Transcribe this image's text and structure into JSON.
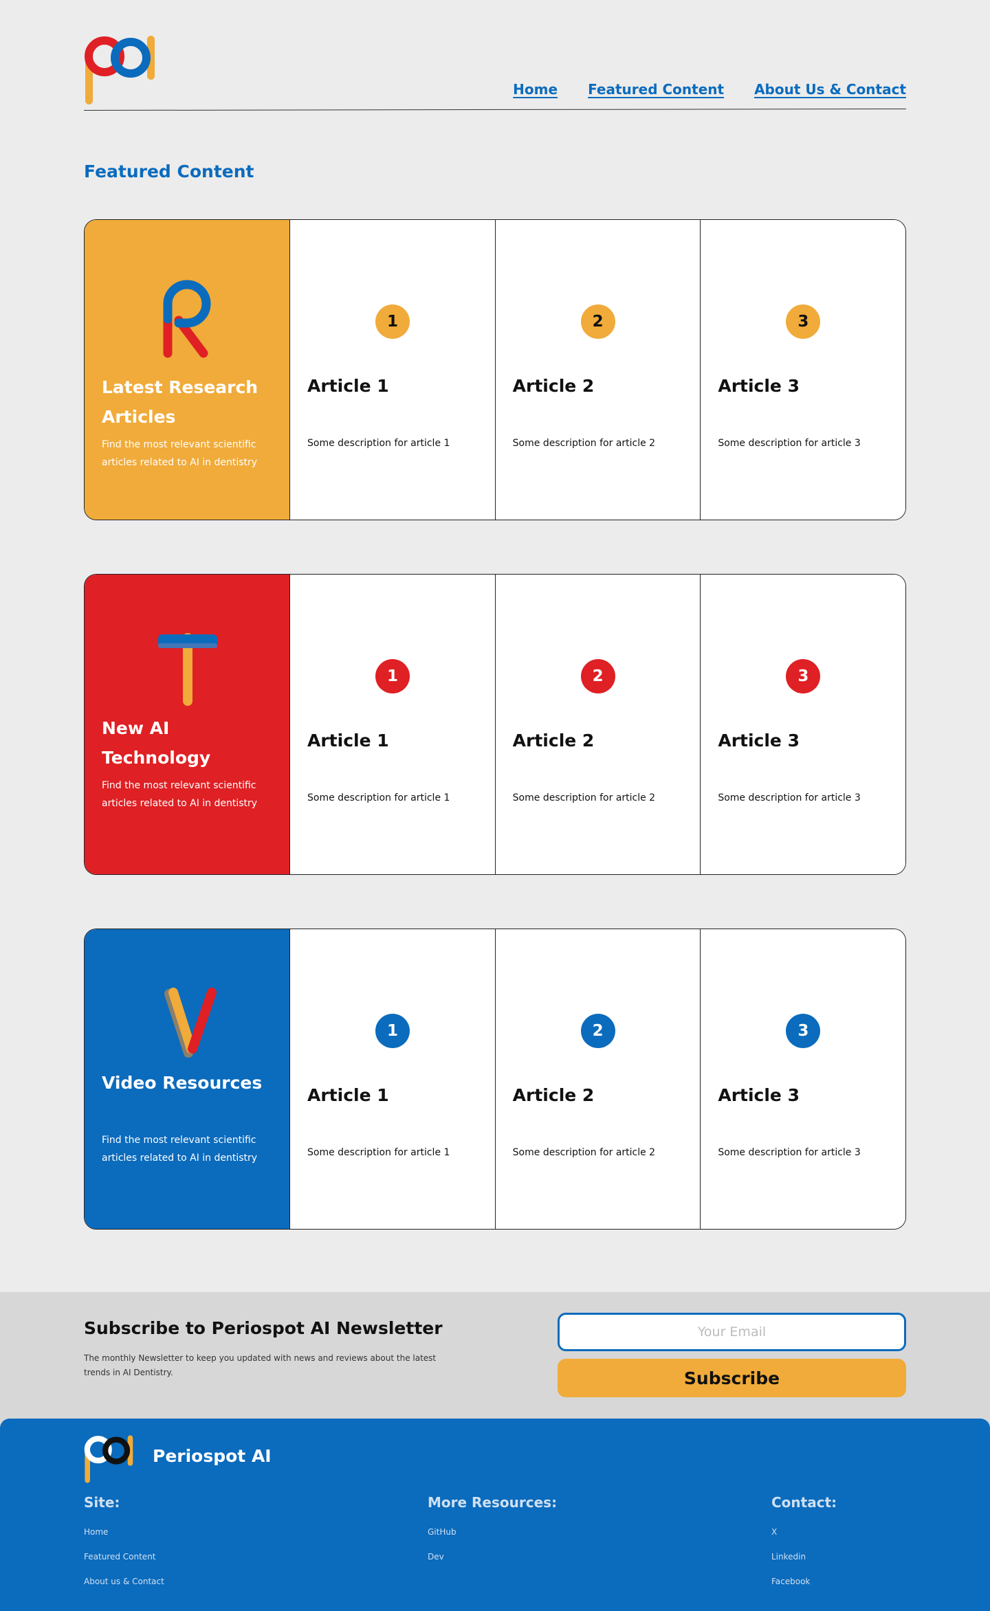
{
  "colors": {
    "blue": "#0b6bbd",
    "red": "#df2024",
    "yellow": "#f0ab3a"
  },
  "nav": {
    "home": "Home",
    "featured": "Featured Content",
    "about": "About Us & Contact"
  },
  "featured_title": "Featured Content",
  "sections": [
    {
      "title": "Latest Research Articles",
      "desc": "Find the most relevant scientific articles related to AI in dentistry",
      "icon": "letter-r-icon",
      "articles": [
        {
          "num": "1",
          "title": "Article 1",
          "desc": "Some description for article 1"
        },
        {
          "num": "2",
          "title": "Article 2",
          "desc": "Some description for article 2"
        },
        {
          "num": "3",
          "title": "Article 3",
          "desc": "Some description for article 3"
        }
      ]
    },
    {
      "title": "New AI Technology",
      "desc": "Find the most relevant scientific articles related to AI in dentistry",
      "icon": "letter-t-icon",
      "articles": [
        {
          "num": "1",
          "title": "Article 1",
          "desc": "Some description for article 1"
        },
        {
          "num": "2",
          "title": "Article 2",
          "desc": "Some description for article 2"
        },
        {
          "num": "3",
          "title": "Article 3",
          "desc": "Some description for article 3"
        }
      ]
    },
    {
      "title": "Video Resources",
      "desc": "Find the most relevant scientific articles related to AI in dentistry",
      "icon": "letter-v-icon",
      "articles": [
        {
          "num": "1",
          "title": "Article 1",
          "desc": "Some description for article 1"
        },
        {
          "num": "2",
          "title": "Article 2",
          "desc": "Some description for article 2"
        },
        {
          "num": "3",
          "title": "Article 3",
          "desc": "Some description for article 3"
        }
      ]
    }
  ],
  "newsletter": {
    "title": "Subscribe to Periospot AI Newsletter",
    "desc": "The monthly Newsletter to keep you updated with news and reviews about the latest trends in AI Dentistry.",
    "email_placeholder": "Your Email",
    "button": "Subscribe"
  },
  "footer": {
    "brand": "Periospot AI",
    "site_head": "Site:",
    "site_links": [
      "Home",
      "Featured Content",
      "About us & Contact"
    ],
    "resources_head": "More Resources:",
    "resources_links": [
      "GitHub",
      "Dev"
    ],
    "contact_head": "Contact:",
    "contact_links": [
      "X",
      "Linkedin",
      "Facebook"
    ]
  }
}
